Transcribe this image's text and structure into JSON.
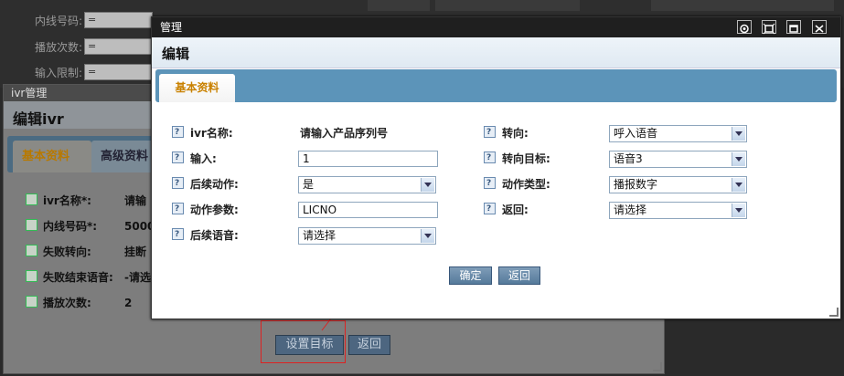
{
  "background": {
    "labels": [
      "内线号码:",
      "播放次数:",
      "输入限制:"
    ],
    "select_value": "="
  },
  "ivr_window": {
    "title": "ivr管理",
    "header": "编辑ivr",
    "tabs": [
      "基本资料",
      "高级资料"
    ],
    "fields": [
      {
        "label": "ivr名称*:",
        "value": "请输"
      },
      {
        "label": "内线号码*:",
        "value": "5000"
      },
      {
        "label": "失败转向:",
        "value": "挂断"
      },
      {
        "label": "失败结束语音:",
        "value": "-请选"
      },
      {
        "label": "播放次数:",
        "value": "2"
      }
    ],
    "buttons": {
      "set_target": "设置目标",
      "back": "返回"
    }
  },
  "dialog": {
    "title": "管理",
    "header": "编辑",
    "tab": "基本资料",
    "left_fields": {
      "ivr_name": {
        "label": "ivr名称:",
        "value": "请输入产品序列号"
      },
      "input": {
        "label": "输入:",
        "value": "1"
      },
      "follow_action": {
        "label": "后续动作:",
        "value": "是"
      },
      "action_param": {
        "label": "动作参数:",
        "value": "LICNO"
      },
      "follow_voice": {
        "label": "后续语音:",
        "value": "请选择"
      }
    },
    "right_fields": {
      "redirect": {
        "label": "转向:",
        "value": "呼入语音"
      },
      "redirect_target": {
        "label": "转向目标:",
        "value": "语音3"
      },
      "action_type": {
        "label": "动作类型:",
        "value": "播报数字"
      },
      "return": {
        "label": "返回:",
        "value": "请选择"
      }
    },
    "buttons": {
      "confirm": "确定",
      "back": "返回"
    }
  },
  "colors": {
    "tab_bar": "#5c94b9",
    "active_tab_text": "#c98100",
    "annotation": "#dd2222"
  }
}
